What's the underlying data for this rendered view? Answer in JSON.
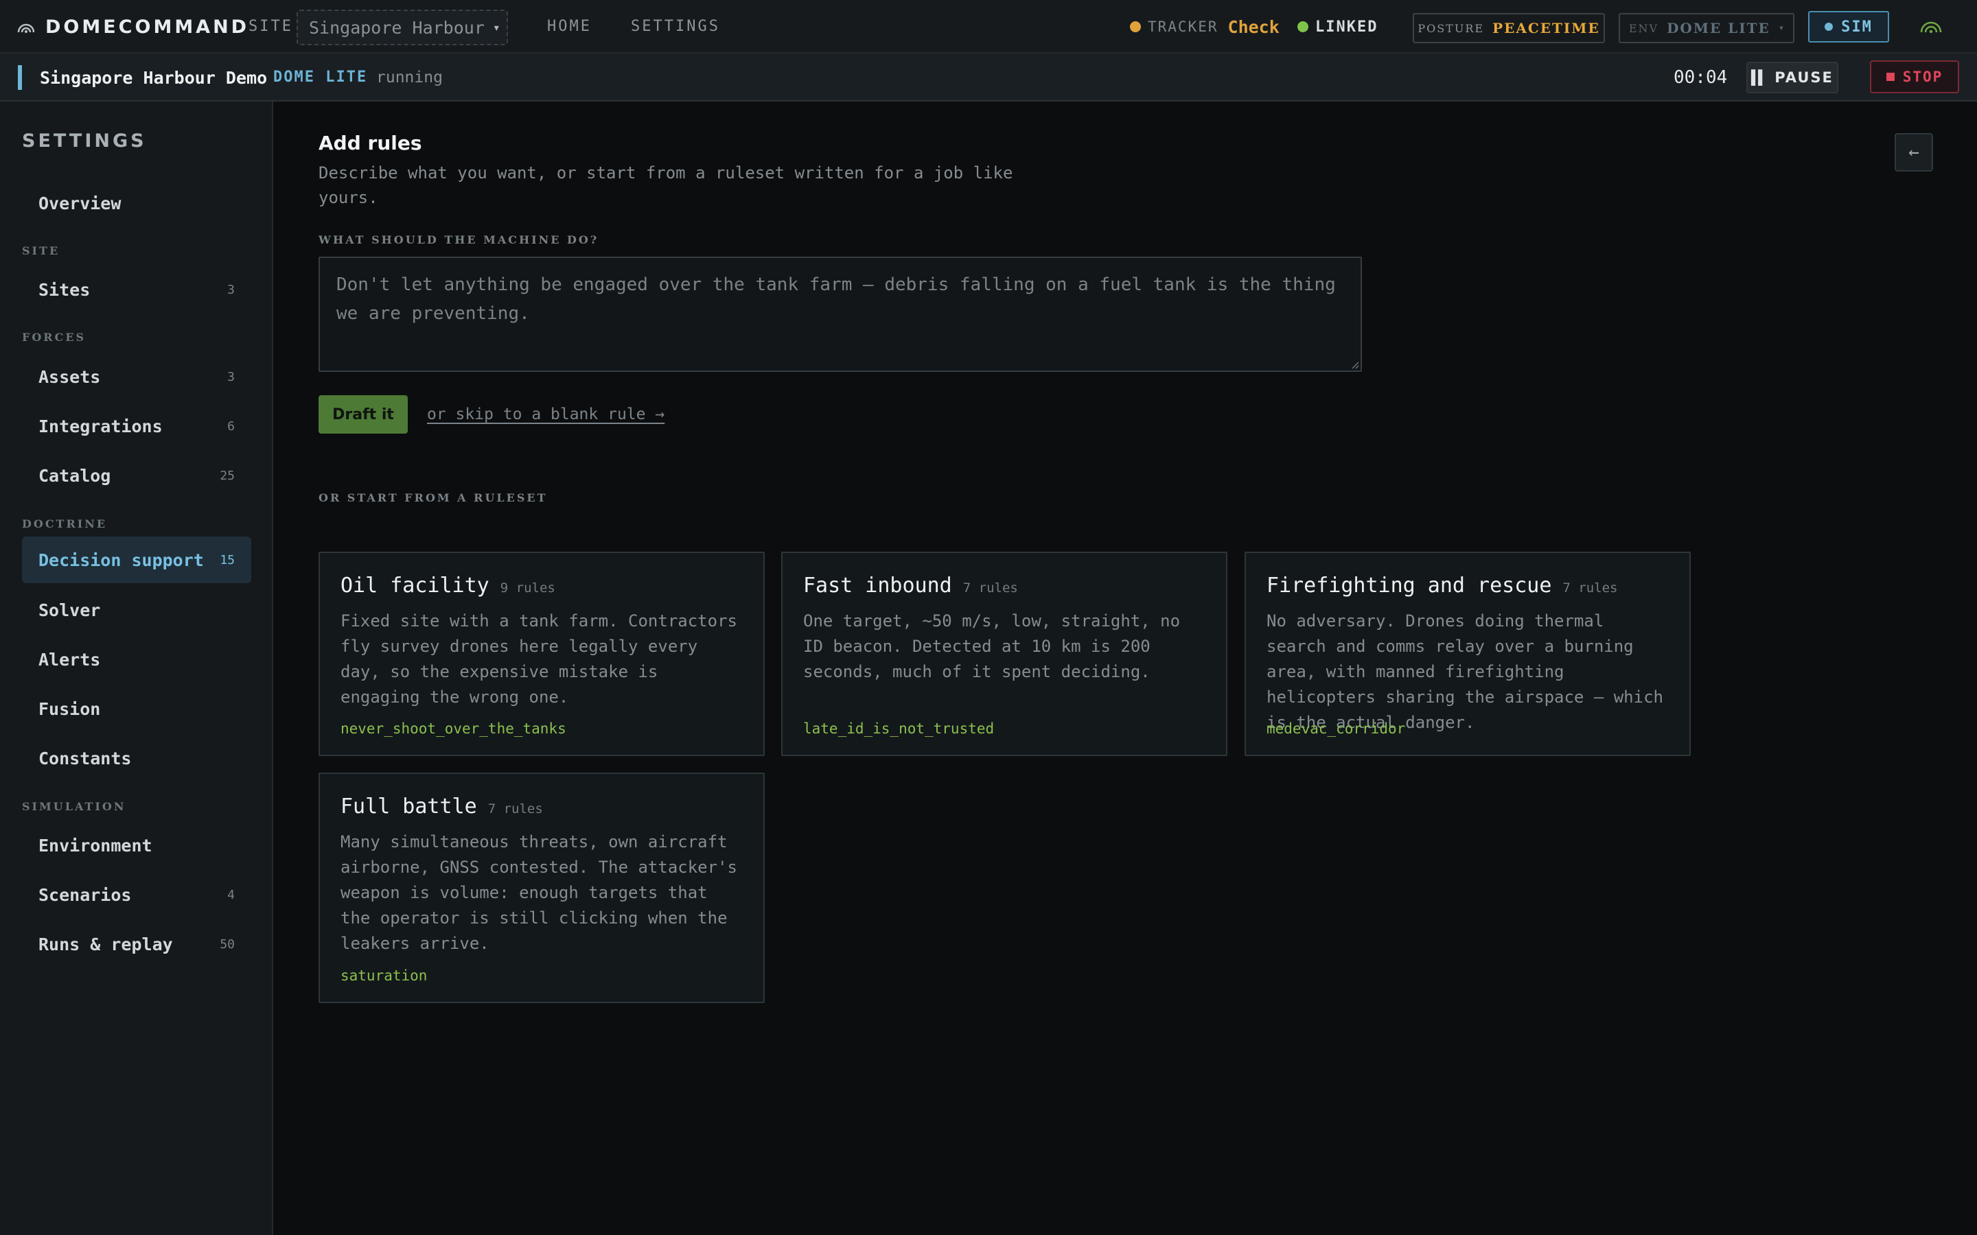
{
  "topbar": {
    "brand": "DOMECOMMAND",
    "site_label": "SITE",
    "site_value": "Singapore Harbour",
    "nav": {
      "home": "HOME",
      "settings": "SETTINGS"
    },
    "tracker_label": "TRACKER",
    "tracker_value": "Check",
    "linked_label": "LINKED",
    "posture_label": "POSTURE",
    "posture_value": "PEACETIME",
    "env_label": "ENV",
    "env_value": "DOME LITE",
    "sim_label": "SIM",
    "colors": {
      "tracker_dot": "#e0a33c",
      "linked_dot": "#7fc44a",
      "sim_dot": "#6fb7d6"
    }
  },
  "status": {
    "run_name": "Singapore Harbour Demo",
    "env": "DOME LITE",
    "state": "running",
    "timer": "00:04",
    "pause_label": "PAUSE",
    "stop_label": "STOP"
  },
  "sidebar": {
    "title": "SETTINGS",
    "overview": "Overview",
    "sections": {
      "site": "SITE",
      "forces": "FORCES",
      "doctrine": "DOCTRINE",
      "simulation": "SIMULATION"
    },
    "items": [
      {
        "label": "Sites",
        "count": "3"
      },
      {
        "label": "Assets",
        "count": "3"
      },
      {
        "label": "Integrations",
        "count": "6"
      },
      {
        "label": "Catalog",
        "count": "25"
      },
      {
        "label": "Decision support",
        "count": "15"
      },
      {
        "label": "Solver",
        "count": ""
      },
      {
        "label": "Alerts",
        "count": ""
      },
      {
        "label": "Fusion",
        "count": ""
      },
      {
        "label": "Constants",
        "count": ""
      },
      {
        "label": "Environment",
        "count": ""
      },
      {
        "label": "Scenarios",
        "count": "4"
      },
      {
        "label": "Runs & replay",
        "count": "50"
      }
    ]
  },
  "main": {
    "title": "Add rules",
    "description": "Describe what you want, or start from a ruleset written for a job like yours.",
    "field_label": "WHAT SHOULD THE MACHINE DO?",
    "prompt_placeholder": "Don't let anything be engaged over the tank farm — debris falling on a fuel tank is the thing we are preventing.",
    "draft_label": "Draft it",
    "skip_link": "or skip to a blank rule →",
    "ruleset_label": "OR START FROM A RULESET",
    "back_icon": "arrow-left-icon"
  },
  "rulesets": [
    {
      "title": "Oil facility",
      "count": "9 rules",
      "description": "Fixed site with a tank farm. Contractors fly survey drones here legally every day, so the expensive mistake is engaging the wrong one.",
      "tag": "never_shoot_over_the_tanks"
    },
    {
      "title": "Fast inbound",
      "count": "7 rules",
      "description": "One target, ~50 m/s, low, straight, no ID beacon. Detected at 10 km is 200 seconds, much of it spent deciding.",
      "tag": "late_id_is_not_trusted"
    },
    {
      "title": "Firefighting and rescue",
      "count": "7 rules",
      "description": "No adversary. Drones doing thermal search and comms relay over a burning area, with manned firefighting helicopters sharing the airspace — which is the actual danger.",
      "tag": "medevac_corridor"
    },
    {
      "title": "Full battle",
      "count": "7 rules",
      "description": "Many simultaneous threats, own aircraft airborne, GNSS contested. The attacker's weapon is volume: enough targets that the operator is still clicking when the leakers arrive.",
      "tag": "saturation"
    }
  ]
}
